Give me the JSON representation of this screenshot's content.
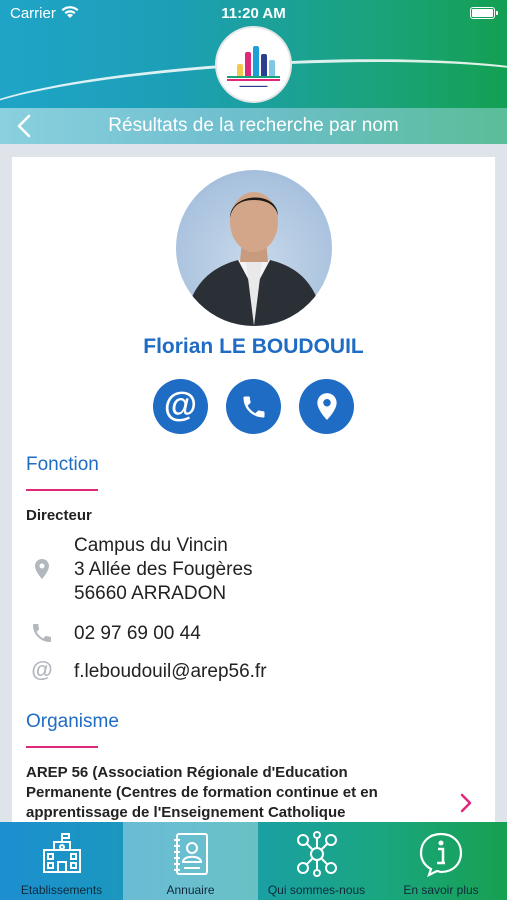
{
  "status": {
    "carrier": "Carrier",
    "time": "11:20 AM"
  },
  "navbar": {
    "title": "Résultats de la recherche par nom"
  },
  "profile": {
    "name": "Florian LE BOUDOUIL",
    "actions": [
      "email",
      "phone",
      "location"
    ]
  },
  "fonction": {
    "title": "Fonction",
    "role": "Directeur",
    "address_line1": "Campus du Vincin",
    "address_line2": "3 Allée des Fougères",
    "address_line3": "56660 ARRADON",
    "phone": "02 97 69 00 44",
    "email": "f.leboudouil@arep56.fr"
  },
  "organisme": {
    "title": "Organisme",
    "line1": "AREP 56 (Association Régionale d'Education",
    "line2": "Permanente (Centres de formation continue et en",
    "line3": "apprentissage de l'Enseignement Catholique"
  },
  "tabs": [
    {
      "label": "Etablissements",
      "icon": "school-icon",
      "active": false
    },
    {
      "label": "Annuaire",
      "icon": "directory-book-icon",
      "active": true
    },
    {
      "label": "Qui sommes-nous",
      "icon": "network-people-icon",
      "active": false
    },
    {
      "label": "En savoir plus",
      "icon": "info-icon",
      "active": false
    }
  ],
  "colors": {
    "accent_blue": "#1f6cc4",
    "underline_pink": "#e0287a",
    "icon_grey": "#b3b8bf"
  }
}
